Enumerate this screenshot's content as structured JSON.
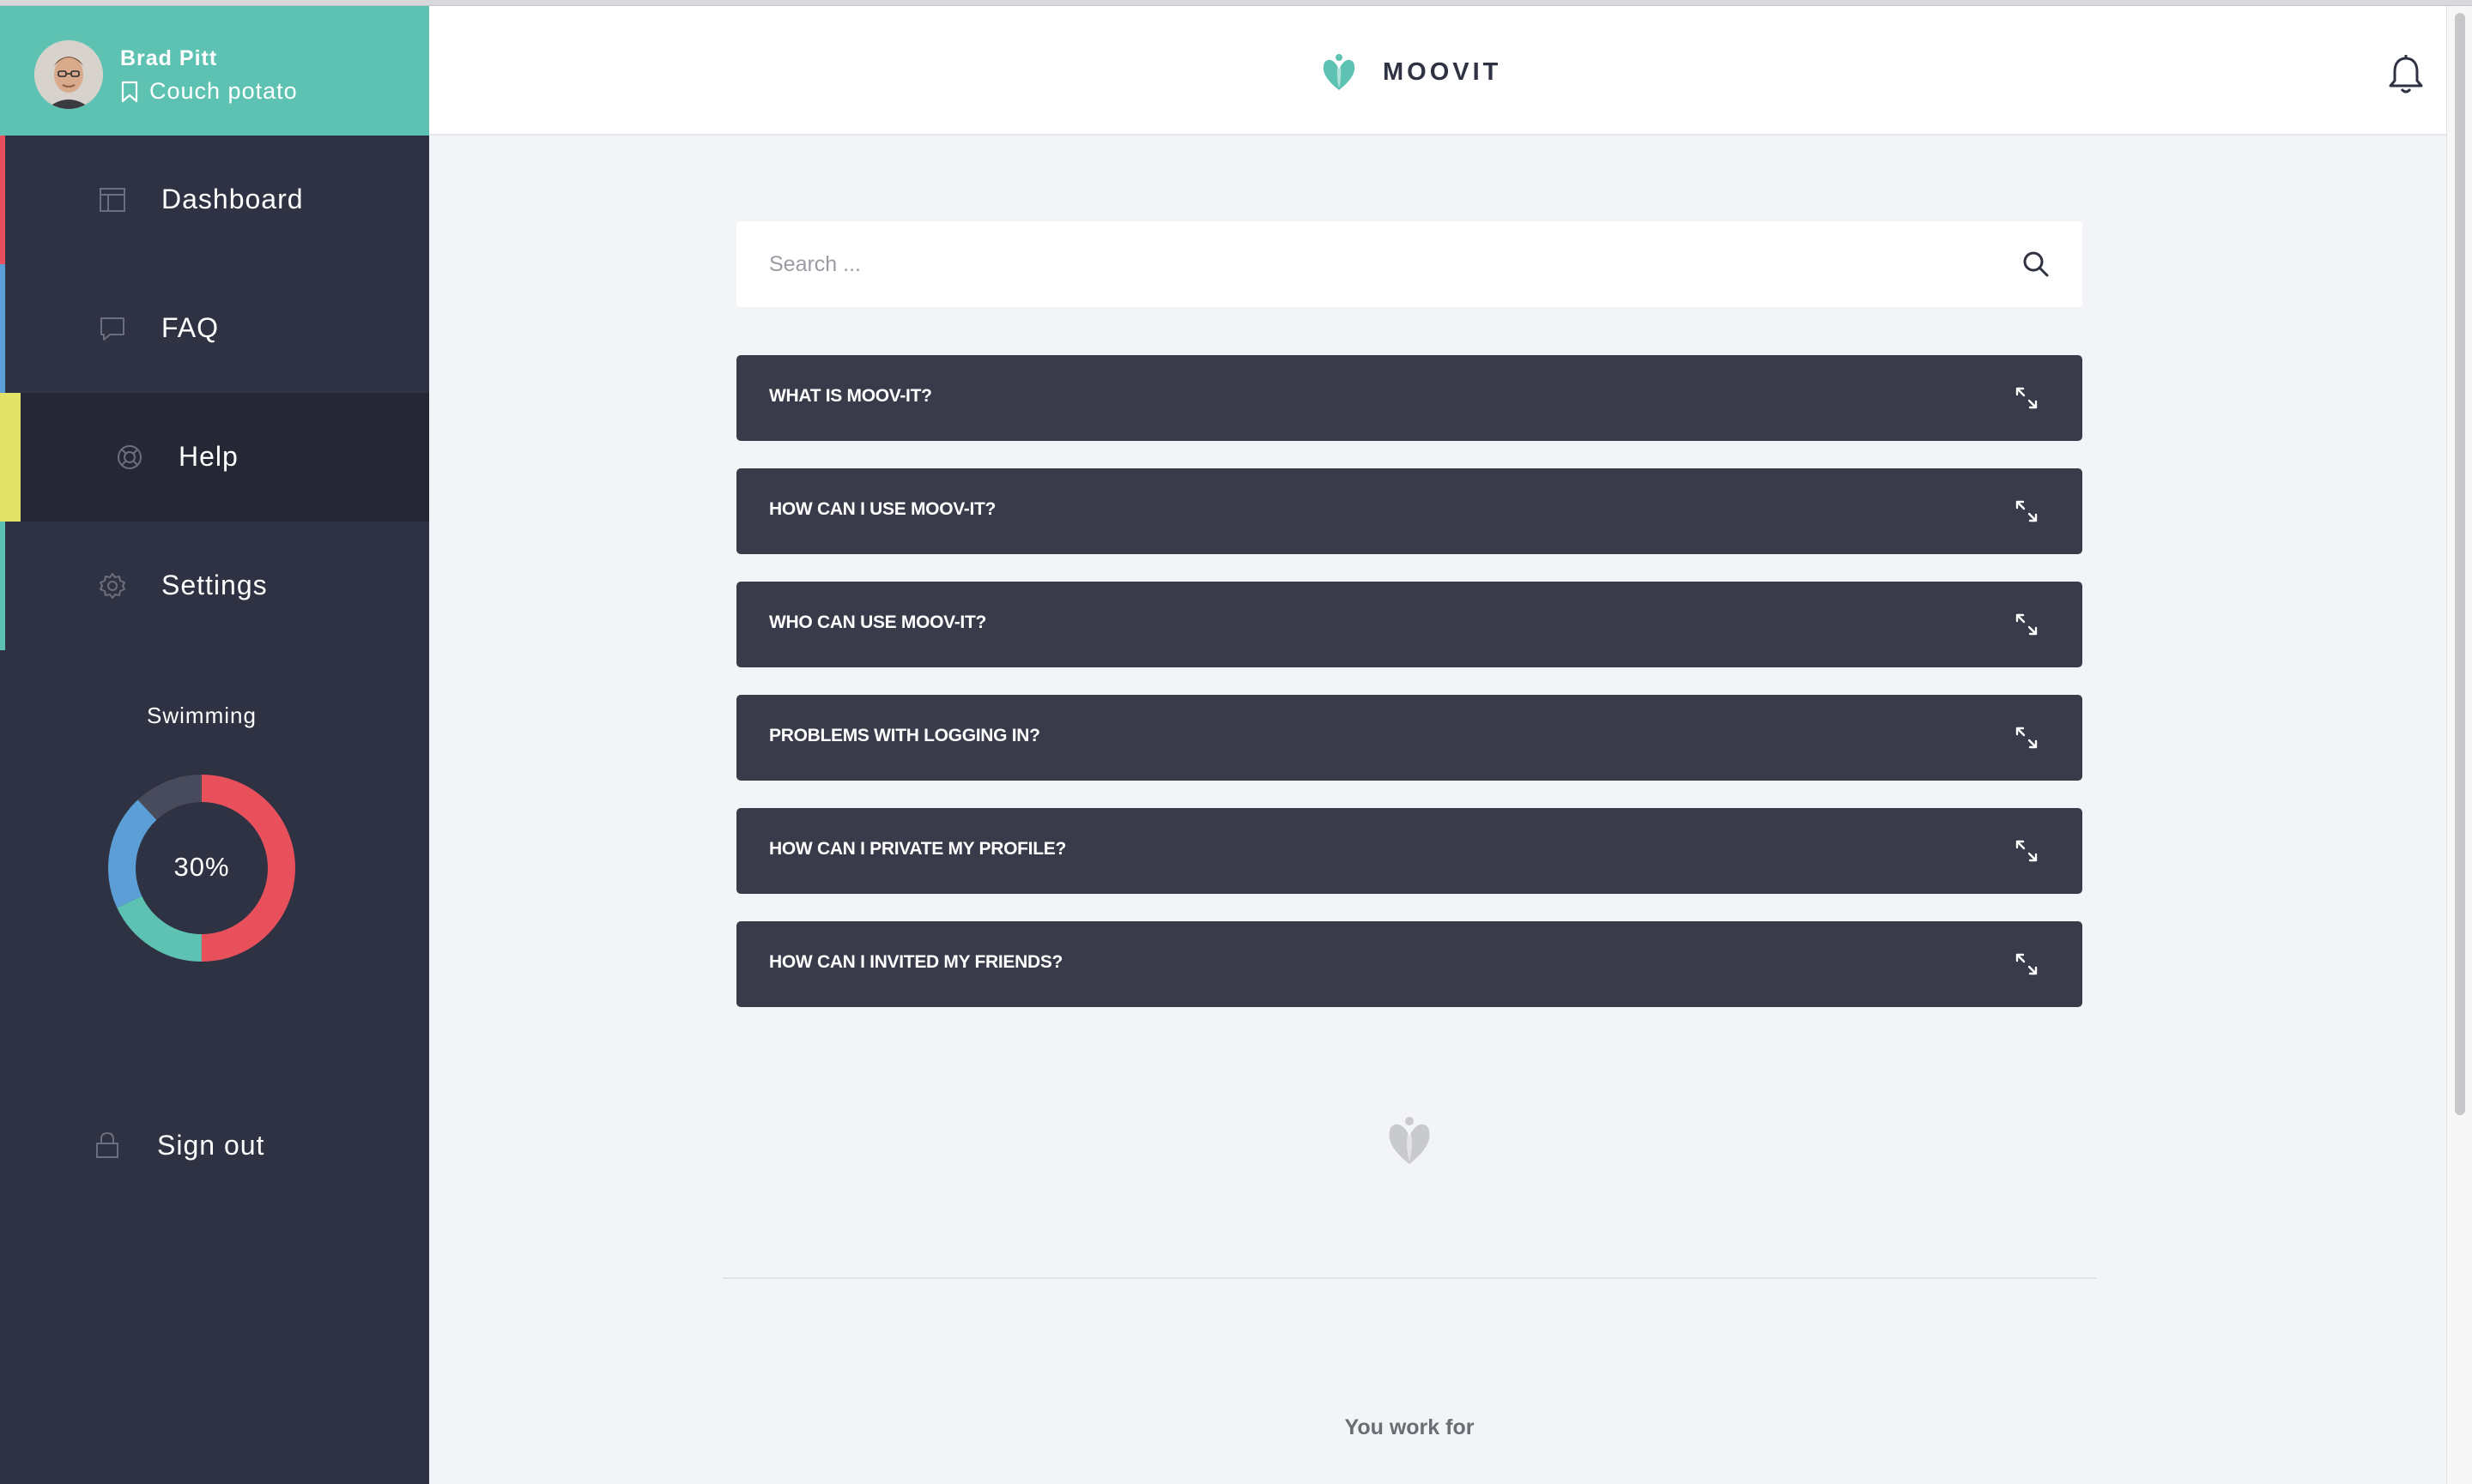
{
  "user": {
    "name": "Brad Pitt",
    "status": "Couch potato"
  },
  "nav": {
    "items": [
      {
        "label": "Dashboard",
        "icon": "dashboard-icon",
        "accent": "#e8505b"
      },
      {
        "label": "FAQ",
        "icon": "chat-icon",
        "accent": "#5b9fd6"
      },
      {
        "label": "Help",
        "icon": "lifebuoy-icon",
        "accent": "#e3e36a",
        "active": true
      },
      {
        "label": "Settings",
        "icon": "gear-icon",
        "accent": "#5ec2b3"
      }
    ],
    "signout_label": "Sign out"
  },
  "activity": {
    "label": "Swimming",
    "value_text": "30%",
    "segments": [
      {
        "color": "#e8505b",
        "fraction": 0.5
      },
      {
        "color": "#5ec2b3",
        "fraction": 0.18
      },
      {
        "color": "#5b9fd6",
        "fraction": 0.2
      },
      {
        "color": "#484b5c",
        "fraction": 0.12
      }
    ]
  },
  "header": {
    "brand": "MOOVIT"
  },
  "search": {
    "placeholder": "Search ..."
  },
  "faq": {
    "questions": [
      "WHAT IS MOOV-IT?",
      "HOW CAN I USE MOOV-IT?",
      "WHO CAN USE MOOV-IT?",
      "PROBLEMS WITH LOGGING IN?",
      "HOW CAN I PRIVATE MY PROFILE?",
      "HOW CAN I INVITED MY FRIENDS?"
    ]
  },
  "footer": {
    "work_for": "You work for"
  },
  "colors": {
    "brand": "#5ec2b3",
    "sidebar": "#2f3242",
    "faq_bg": "#393b4a"
  }
}
